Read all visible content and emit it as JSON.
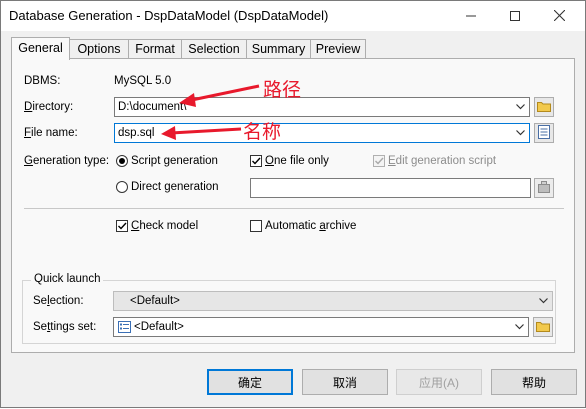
{
  "window": {
    "title": "Database Generation - DspDataModel (DspDataModel)"
  },
  "tabs": [
    "General",
    "Options",
    "Format",
    "Selection",
    "Summary",
    "Preview"
  ],
  "general": {
    "dbms_label": "DBMS:",
    "dbms_value": "MySQL 5.0",
    "directory_label_mnemonic": "D",
    "directory_label_rest": "irectory:",
    "directory_value": "D:\\document\\",
    "filename_label_mnemonic": "F",
    "filename_label_rest": "ile name:",
    "filename_value": "dsp.sql",
    "gentype_label_mnemonic": "G",
    "gentype_label_rest": "eneration type:",
    "script_generation": "Script generation",
    "direct_generation": "Direct generation",
    "one_file_only_mnemonic": "O",
    "one_file_only_rest": "ne file only",
    "edit_script_mnemonic": "E",
    "edit_script_rest": "dit generation script",
    "check_model_mnemonic": "C",
    "check_model_rest": "heck model",
    "auto_archive_prefix": "Automatic ",
    "auto_archive_mnemonic": "a",
    "auto_archive_rest": "rchive"
  },
  "quick_launch": {
    "title": "Quick launch",
    "selection_label_prefix": "Se",
    "selection_label_mnemonic": "l",
    "selection_label_rest": "ection:",
    "selection_value": "<Default>",
    "settings_label_prefix": "Se",
    "settings_label_mnemonic": "t",
    "settings_label_rest": "tings set:",
    "settings_value": "<Default>"
  },
  "annotations": {
    "path": "路径",
    "name": "名称"
  },
  "buttons": {
    "ok": "确定",
    "cancel": "取消",
    "apply": "应用(A)",
    "help": "帮助"
  },
  "state": {
    "generation_type": "script",
    "one_file_only": true,
    "edit_generation_script": true,
    "check_model": true,
    "automatic_archive": false
  },
  "colors": {
    "annotation": "#e8192c",
    "focus": "#0078d7"
  }
}
